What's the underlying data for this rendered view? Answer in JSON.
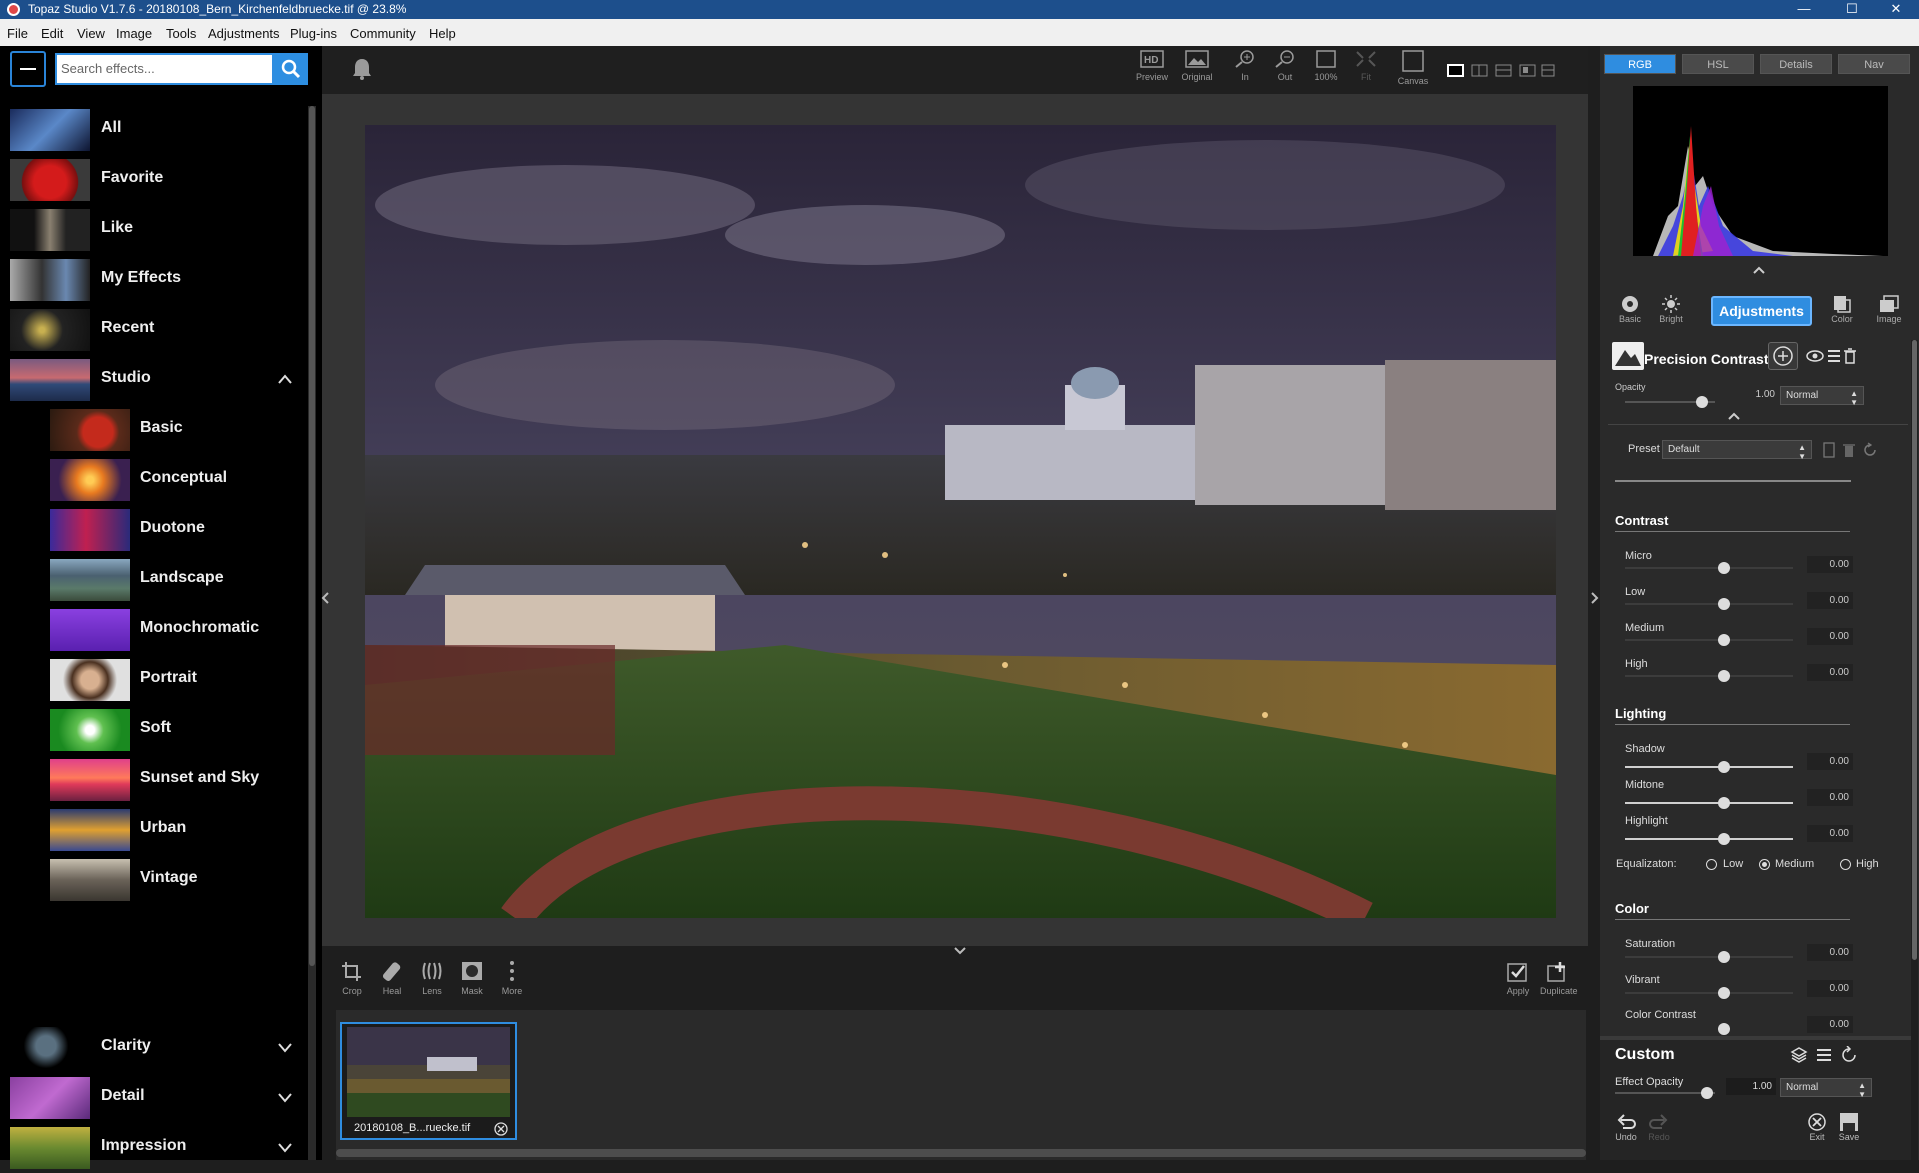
{
  "window": {
    "title": "Topaz Studio V1.7.6 - 20180108_Bern_Kirchenfeldbruecke.tif @ 23.8%",
    "controls": [
      "—",
      "☐",
      "✕"
    ]
  },
  "menu": [
    "File",
    "Edit",
    "View",
    "Image",
    "Tools",
    "Adjustments",
    "Plug-ins",
    "Community",
    "Help"
  ],
  "search": {
    "placeholder": "Search effects..."
  },
  "categories": [
    {
      "label": "All"
    },
    {
      "label": "Favorite"
    },
    {
      "label": "Like"
    },
    {
      "label": "My Effects"
    },
    {
      "label": "Recent"
    },
    {
      "label": "Studio"
    }
  ],
  "studio_sub": [
    {
      "label": "Basic"
    },
    {
      "label": "Conceptual"
    },
    {
      "label": "Duotone"
    },
    {
      "label": "Landscape"
    },
    {
      "label": "Monochromatic"
    },
    {
      "label": "Portrait"
    },
    {
      "label": "Soft"
    },
    {
      "label": "Sunset and Sky"
    },
    {
      "label": "Urban"
    },
    {
      "label": "Vintage"
    }
  ],
  "collapsed_categories": [
    {
      "label": "Clarity"
    },
    {
      "label": "Detail"
    },
    {
      "label": "Impression"
    }
  ],
  "toolbar": {
    "preview": "Preview",
    "original": "Original",
    "zoom_in": "In",
    "zoom_out": "Out",
    "zoom_100": "100%",
    "fit": "Fit",
    "canvas": "Canvas"
  },
  "bottom_tools": {
    "crop": "Crop",
    "heal": "Heal",
    "lens": "Lens",
    "mask": "Mask",
    "more": "More",
    "apply": "Apply",
    "duplicate": "Duplicate"
  },
  "filmstrip": {
    "filename": "20180108_B...ruecke.tif"
  },
  "right": {
    "tabs": [
      "RGB",
      "HSL",
      "Details",
      "Nav"
    ],
    "modes": {
      "basic": "Basic",
      "bright": "Bright",
      "adjustments": "Adjustments",
      "color": "Color",
      "image": "Image"
    },
    "filter_name": "Precision Contrast",
    "opacity_label": "Opacity",
    "opacity_value": "1.00",
    "blend_mode": "Normal",
    "preset_label": "Preset",
    "preset_value": "Default",
    "sections": {
      "contrast": "Contrast",
      "lighting": "Lighting",
      "color": "Color"
    },
    "contrast_sliders": [
      {
        "label": "Micro",
        "value": "0.00"
      },
      {
        "label": "Low",
        "value": "0.00"
      },
      {
        "label": "Medium",
        "value": "0.00"
      },
      {
        "label": "High",
        "value": "0.00"
      }
    ],
    "lighting_sliders": [
      {
        "label": "Shadow",
        "value": "0.00"
      },
      {
        "label": "Midtone",
        "value": "0.00"
      },
      {
        "label": "Highlight",
        "value": "0.00"
      }
    ],
    "equalization": {
      "label": "Equalizaton:",
      "options": [
        "Low",
        "Medium",
        "High"
      ],
      "selected": "Medium"
    },
    "color_sliders": [
      {
        "label": "Saturation",
        "value": "0.00"
      },
      {
        "label": "Vibrant",
        "value": "0.00"
      },
      {
        "label": "Color Contrast",
        "value": "0.00"
      }
    ],
    "custom": {
      "title": "Custom",
      "effect_opacity_label": "Effect Opacity",
      "effect_opacity_value": "1.00",
      "blend_mode": "Normal",
      "undo": "Undo",
      "redo": "Redo",
      "exit": "Exit",
      "save": "Save"
    }
  }
}
